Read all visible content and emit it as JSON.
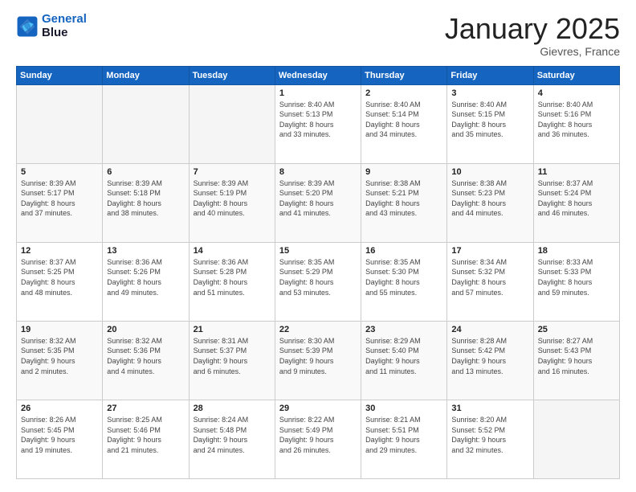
{
  "logo": {
    "line1": "General",
    "line2": "Blue"
  },
  "title": "January 2025",
  "location": "Gievres, France",
  "days_header": [
    "Sunday",
    "Monday",
    "Tuesday",
    "Wednesday",
    "Thursday",
    "Friday",
    "Saturday"
  ],
  "rows": [
    [
      {
        "day": "",
        "detail": "",
        "empty": true
      },
      {
        "day": "",
        "detail": "",
        "empty": true
      },
      {
        "day": "",
        "detail": "",
        "empty": true
      },
      {
        "day": "1",
        "detail": "Sunrise: 8:40 AM\nSunset: 5:13 PM\nDaylight: 8 hours\nand 33 minutes.",
        "empty": false
      },
      {
        "day": "2",
        "detail": "Sunrise: 8:40 AM\nSunset: 5:14 PM\nDaylight: 8 hours\nand 34 minutes.",
        "empty": false
      },
      {
        "day": "3",
        "detail": "Sunrise: 8:40 AM\nSunset: 5:15 PM\nDaylight: 8 hours\nand 35 minutes.",
        "empty": false
      },
      {
        "day": "4",
        "detail": "Sunrise: 8:40 AM\nSunset: 5:16 PM\nDaylight: 8 hours\nand 36 minutes.",
        "empty": false
      }
    ],
    [
      {
        "day": "5",
        "detail": "Sunrise: 8:39 AM\nSunset: 5:17 PM\nDaylight: 8 hours\nand 37 minutes.",
        "empty": false
      },
      {
        "day": "6",
        "detail": "Sunrise: 8:39 AM\nSunset: 5:18 PM\nDaylight: 8 hours\nand 38 minutes.",
        "empty": false
      },
      {
        "day": "7",
        "detail": "Sunrise: 8:39 AM\nSunset: 5:19 PM\nDaylight: 8 hours\nand 40 minutes.",
        "empty": false
      },
      {
        "day": "8",
        "detail": "Sunrise: 8:39 AM\nSunset: 5:20 PM\nDaylight: 8 hours\nand 41 minutes.",
        "empty": false
      },
      {
        "day": "9",
        "detail": "Sunrise: 8:38 AM\nSunset: 5:21 PM\nDaylight: 8 hours\nand 43 minutes.",
        "empty": false
      },
      {
        "day": "10",
        "detail": "Sunrise: 8:38 AM\nSunset: 5:23 PM\nDaylight: 8 hours\nand 44 minutes.",
        "empty": false
      },
      {
        "day": "11",
        "detail": "Sunrise: 8:37 AM\nSunset: 5:24 PM\nDaylight: 8 hours\nand 46 minutes.",
        "empty": false
      }
    ],
    [
      {
        "day": "12",
        "detail": "Sunrise: 8:37 AM\nSunset: 5:25 PM\nDaylight: 8 hours\nand 48 minutes.",
        "empty": false
      },
      {
        "day": "13",
        "detail": "Sunrise: 8:36 AM\nSunset: 5:26 PM\nDaylight: 8 hours\nand 49 minutes.",
        "empty": false
      },
      {
        "day": "14",
        "detail": "Sunrise: 8:36 AM\nSunset: 5:28 PM\nDaylight: 8 hours\nand 51 minutes.",
        "empty": false
      },
      {
        "day": "15",
        "detail": "Sunrise: 8:35 AM\nSunset: 5:29 PM\nDaylight: 8 hours\nand 53 minutes.",
        "empty": false
      },
      {
        "day": "16",
        "detail": "Sunrise: 8:35 AM\nSunset: 5:30 PM\nDaylight: 8 hours\nand 55 minutes.",
        "empty": false
      },
      {
        "day": "17",
        "detail": "Sunrise: 8:34 AM\nSunset: 5:32 PM\nDaylight: 8 hours\nand 57 minutes.",
        "empty": false
      },
      {
        "day": "18",
        "detail": "Sunrise: 8:33 AM\nSunset: 5:33 PM\nDaylight: 8 hours\nand 59 minutes.",
        "empty": false
      }
    ],
    [
      {
        "day": "19",
        "detail": "Sunrise: 8:32 AM\nSunset: 5:35 PM\nDaylight: 9 hours\nand 2 minutes.",
        "empty": false
      },
      {
        "day": "20",
        "detail": "Sunrise: 8:32 AM\nSunset: 5:36 PM\nDaylight: 9 hours\nand 4 minutes.",
        "empty": false
      },
      {
        "day": "21",
        "detail": "Sunrise: 8:31 AM\nSunset: 5:37 PM\nDaylight: 9 hours\nand 6 minutes.",
        "empty": false
      },
      {
        "day": "22",
        "detail": "Sunrise: 8:30 AM\nSunset: 5:39 PM\nDaylight: 9 hours\nand 9 minutes.",
        "empty": false
      },
      {
        "day": "23",
        "detail": "Sunrise: 8:29 AM\nSunset: 5:40 PM\nDaylight: 9 hours\nand 11 minutes.",
        "empty": false
      },
      {
        "day": "24",
        "detail": "Sunrise: 8:28 AM\nSunset: 5:42 PM\nDaylight: 9 hours\nand 13 minutes.",
        "empty": false
      },
      {
        "day": "25",
        "detail": "Sunrise: 8:27 AM\nSunset: 5:43 PM\nDaylight: 9 hours\nand 16 minutes.",
        "empty": false
      }
    ],
    [
      {
        "day": "26",
        "detail": "Sunrise: 8:26 AM\nSunset: 5:45 PM\nDaylight: 9 hours\nand 19 minutes.",
        "empty": false
      },
      {
        "day": "27",
        "detail": "Sunrise: 8:25 AM\nSunset: 5:46 PM\nDaylight: 9 hours\nand 21 minutes.",
        "empty": false
      },
      {
        "day": "28",
        "detail": "Sunrise: 8:24 AM\nSunset: 5:48 PM\nDaylight: 9 hours\nand 24 minutes.",
        "empty": false
      },
      {
        "day": "29",
        "detail": "Sunrise: 8:22 AM\nSunset: 5:49 PM\nDaylight: 9 hours\nand 26 minutes.",
        "empty": false
      },
      {
        "day": "30",
        "detail": "Sunrise: 8:21 AM\nSunset: 5:51 PM\nDaylight: 9 hours\nand 29 minutes.",
        "empty": false
      },
      {
        "day": "31",
        "detail": "Sunrise: 8:20 AM\nSunset: 5:52 PM\nDaylight: 9 hours\nand 32 minutes.",
        "empty": false
      },
      {
        "day": "",
        "detail": "",
        "empty": true
      }
    ]
  ]
}
